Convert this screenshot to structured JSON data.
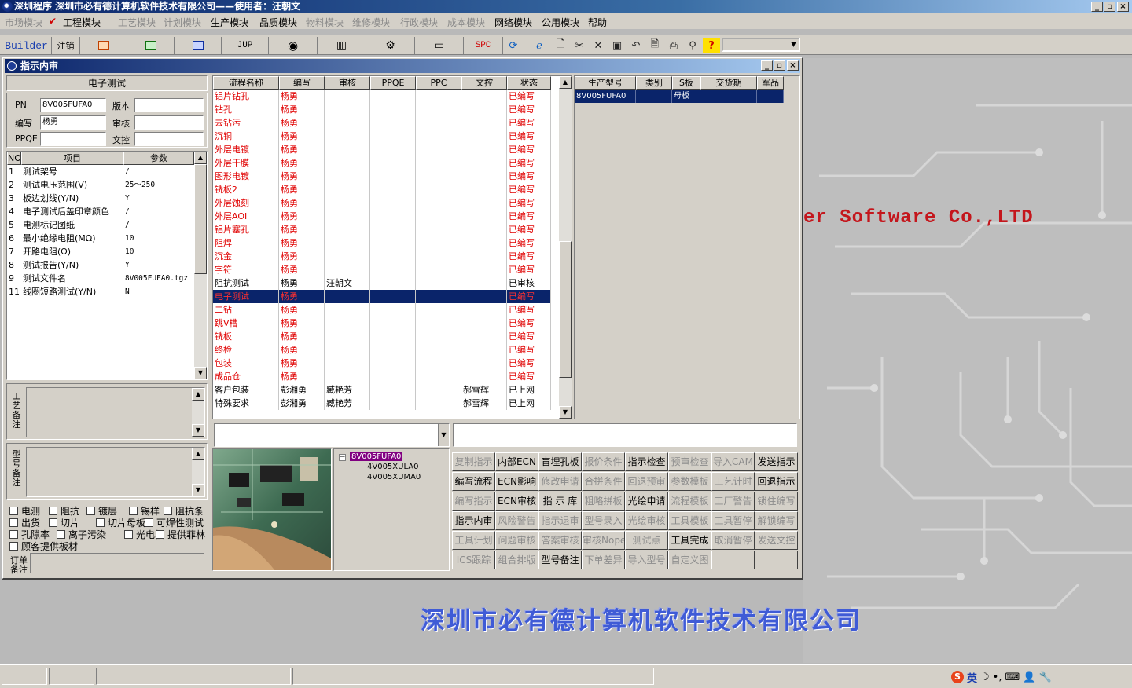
{
  "app": {
    "title": "深圳程序    深圳市必有德计算机软件技术有限公司——使用者：汪朝文",
    "controls": [
      "_",
      "▫",
      "×"
    ]
  },
  "menu": [
    {
      "label": "市场模块",
      "enabled": false
    },
    {
      "label": "工程模块",
      "enabled": true,
      "checked": true
    },
    {
      "label": "工艺模块",
      "enabled": false
    },
    {
      "label": "计划模块",
      "enabled": false
    },
    {
      "label": "生产模块",
      "enabled": true
    },
    {
      "label": "品质模块",
      "enabled": true
    },
    {
      "label": "物料模块",
      "enabled": false
    },
    {
      "label": "维修模块",
      "enabled": false
    },
    {
      "label": "行政模块",
      "enabled": false
    },
    {
      "label": "成本模块",
      "enabled": false
    },
    {
      "label": "网络模块",
      "enabled": true
    },
    {
      "label": "公用模块",
      "enabled": true
    },
    {
      "label": "帮助",
      "enabled": true
    }
  ],
  "toolbar": {
    "builder": "Builder",
    "logout": "注销",
    "jup": "JUP",
    "spc": "SPC",
    "icons": [
      "ppt-icon",
      "excel-icon",
      "word-icon",
      "jup-icon",
      "eye-icon",
      "database-icon",
      "network-icon",
      "computer-icon",
      "spc-icon",
      "refresh-icon",
      "ie-icon",
      "new-icon",
      "cut-icon",
      "delete-icon",
      "save-icon",
      "undo-icon",
      "preview-icon",
      "print-icon",
      "find-icon",
      "help-icon"
    ]
  },
  "background": {
    "company_en": "er Software Co.,LTD",
    "company_cn": "深圳市必有德计算机软件技术有限公司"
  },
  "window": {
    "title": "指示内审",
    "left": {
      "section_title": "电子测试",
      "pn_label": "PN",
      "pn_value": "8V005FUFA0",
      "version_label": "版本",
      "version_value": "",
      "author_label": "编写",
      "author_value": "杨勇",
      "review_label": "审核",
      "review_value": "",
      "ppqe_label": "PPQE",
      "ppqe_value": "",
      "doc_label": "文控",
      "doc_value": "",
      "param_headers": [
        "NO",
        "项目",
        "参数"
      ],
      "params": [
        {
          "no": "1",
          "item": "测试架号",
          "value": "/"
        },
        {
          "no": "2",
          "item": "测试电压范围(V)",
          "value": "25～250"
        },
        {
          "no": "3",
          "item": "板边划线(Y/N)",
          "value": "Y"
        },
        {
          "no": "4",
          "item": "电子测试后盖印章颜色",
          "value": "/"
        },
        {
          "no": "5",
          "item": "电测标记图纸",
          "value": "/"
        },
        {
          "no": "6",
          "item": "最小绝缘电阻(MΩ)",
          "value": "10"
        },
        {
          "no": "7",
          "item": "开路电阻(Ω)",
          "value": "10"
        },
        {
          "no": "8",
          "item": "测试报告(Y/N)",
          "value": "Y"
        },
        {
          "no": "9",
          "item": "测试文件名",
          "value": "8V005FUFA0.tgz"
        },
        {
          "no": "11",
          "item": "线圈短路测试(Y/N)",
          "value": "N"
        }
      ],
      "process_note_label": "工艺备注",
      "model_note_label": "型号备注",
      "order_note_label": "订单备注",
      "checkboxes": [
        [
          "电测",
          "阻抗",
          "镀层",
          "锡样",
          "阻抗条"
        ],
        [
          "出货",
          "切片",
          "切片母板",
          "可焊性测试"
        ],
        [
          "孔隙率",
          "离子污染",
          "光电板",
          "提供菲林"
        ],
        [
          "顾客提供板材"
        ]
      ]
    },
    "process": {
      "headers": [
        "流程名称",
        "编写",
        "审核",
        "PPQE",
        "PPC",
        "文控",
        "状态"
      ],
      "rows": [
        {
          "name": "铝片钻孔",
          "author": "杨勇",
          "review": "",
          "ppqe": "",
          "ppc": "",
          "doc": "",
          "status": "已编写",
          "red": true
        },
        {
          "name": "钻孔",
          "author": "杨勇",
          "review": "",
          "ppqe": "",
          "ppc": "",
          "doc": "",
          "status": "已编写",
          "red": true
        },
        {
          "name": "去钻污",
          "author": "杨勇",
          "review": "",
          "ppqe": "",
          "ppc": "",
          "doc": "",
          "status": "已编写",
          "red": true
        },
        {
          "name": "沉铜",
          "author": "杨勇",
          "review": "",
          "ppqe": "",
          "ppc": "",
          "doc": "",
          "status": "已编写",
          "red": true
        },
        {
          "name": "外层电镀",
          "author": "杨勇",
          "review": "",
          "ppqe": "",
          "ppc": "",
          "doc": "",
          "status": "已编写",
          "red": true
        },
        {
          "name": "外层干膜",
          "author": "杨勇",
          "review": "",
          "ppqe": "",
          "ppc": "",
          "doc": "",
          "status": "已编写",
          "red": true
        },
        {
          "name": "图形电镀",
          "author": "杨勇",
          "review": "",
          "ppqe": "",
          "ppc": "",
          "doc": "",
          "status": "已编写",
          "red": true
        },
        {
          "name": "铣板2",
          "author": "杨勇",
          "review": "",
          "ppqe": "",
          "ppc": "",
          "doc": "",
          "status": "已编写",
          "red": true
        },
        {
          "name": "外层蚀刻",
          "author": "杨勇",
          "review": "",
          "ppqe": "",
          "ppc": "",
          "doc": "",
          "status": "已编写",
          "red": true
        },
        {
          "name": "外层AOI",
          "author": "杨勇",
          "review": "",
          "ppqe": "",
          "ppc": "",
          "doc": "",
          "status": "已编写",
          "red": true
        },
        {
          "name": "铝片塞孔",
          "author": "杨勇",
          "review": "",
          "ppqe": "",
          "ppc": "",
          "doc": "",
          "status": "已编写",
          "red": true
        },
        {
          "name": "阻焊",
          "author": "杨勇",
          "review": "",
          "ppqe": "",
          "ppc": "",
          "doc": "",
          "status": "已编写",
          "red": true
        },
        {
          "name": "沉金",
          "author": "杨勇",
          "review": "",
          "ppqe": "",
          "ppc": "",
          "doc": "",
          "status": "已编写",
          "red": true
        },
        {
          "name": "字符",
          "author": "杨勇",
          "review": "",
          "ppqe": "",
          "ppc": "",
          "doc": "",
          "status": "已编写",
          "red": true
        },
        {
          "name": "阻抗测试",
          "author": "杨勇",
          "review": "汪朝文",
          "ppqe": "",
          "ppc": "",
          "doc": "",
          "status": "已审核",
          "red": false
        },
        {
          "name": "电子测试",
          "author": "杨勇",
          "review": "",
          "ppqe": "",
          "ppc": "",
          "doc": "",
          "status": "已编写",
          "red": true,
          "selected": true
        },
        {
          "name": "二钻",
          "author": "杨勇",
          "review": "",
          "ppqe": "",
          "ppc": "",
          "doc": "",
          "status": "已编写",
          "red": true
        },
        {
          "name": "跳V槽",
          "author": "杨勇",
          "review": "",
          "ppqe": "",
          "ppc": "",
          "doc": "",
          "status": "已编写",
          "red": true
        },
        {
          "name": "铣板",
          "author": "杨勇",
          "review": "",
          "ppqe": "",
          "ppc": "",
          "doc": "",
          "status": "已编写",
          "red": true
        },
        {
          "name": "终检",
          "author": "杨勇",
          "review": "",
          "ppqe": "",
          "ppc": "",
          "doc": "",
          "status": "已编写",
          "red": true
        },
        {
          "name": "包装",
          "author": "杨勇",
          "review": "",
          "ppqe": "",
          "ppc": "",
          "doc": "",
          "status": "已编写",
          "red": true
        },
        {
          "name": "成品仓",
          "author": "杨勇",
          "review": "",
          "ppqe": "",
          "ppc": "",
          "doc": "",
          "status": "已编写",
          "red": true
        },
        {
          "name": "客户包装",
          "author": "彭湘勇",
          "review": "臧艳芳",
          "ppqe": "",
          "ppc": "",
          "doc": "郝雪辉",
          "status": "已上网",
          "red": false
        },
        {
          "name": "特殊要求",
          "author": "彭湘勇",
          "review": "臧艳芳",
          "ppqe": "",
          "ppc": "",
          "doc": "郝雪辉",
          "status": "已上网",
          "red": false
        }
      ]
    },
    "production": {
      "headers": [
        "生产型号",
        "类别",
        "S板",
        "交货期",
        "军品"
      ],
      "rows": [
        {
          "model": "8V005FUFA0",
          "type": "",
          "s_board": "母板",
          "delivery": "",
          "military": ""
        }
      ]
    },
    "combo_value": "",
    "text_value": "",
    "tree": {
      "root": "8V005FUFA0",
      "children": [
        "4V005XULA0",
        "4V005XUMA0"
      ]
    },
    "buttons": [
      [
        {
          "label": "复制指示",
          "enabled": false
        },
        {
          "label": "内部ECN",
          "enabled": true
        },
        {
          "label": "盲埋孔板",
          "enabled": true
        },
        {
          "label": "报价条件",
          "enabled": false
        },
        {
          "label": "指示检查",
          "enabled": true
        },
        {
          "label": "预审检查",
          "enabled": false
        },
        {
          "label": "导入CAM",
          "enabled": false
        },
        {
          "label": "发送指示",
          "enabled": true
        }
      ],
      [
        {
          "label": "编写流程",
          "enabled": true
        },
        {
          "label": "ECN影响",
          "enabled": true
        },
        {
          "label": "修改申请",
          "enabled": false
        },
        {
          "label": "合拼条件",
          "enabled": false
        },
        {
          "label": "回退预审",
          "enabled": false
        },
        {
          "label": "参数模板",
          "enabled": false
        },
        {
          "label": "工艺计时",
          "enabled": false
        },
        {
          "label": "回退指示",
          "enabled": true
        }
      ],
      [
        {
          "label": "编写指示",
          "enabled": false
        },
        {
          "label": "ECN审核",
          "enabled": true
        },
        {
          "label": "指 示 库",
          "enabled": true
        },
        {
          "label": "粗略拼板",
          "enabled": false
        },
        {
          "label": "光绘申请",
          "enabled": true
        },
        {
          "label": "流程模板",
          "enabled": false
        },
        {
          "label": "工厂警告",
          "enabled": false
        },
        {
          "label": "锁住编写",
          "enabled": false
        }
      ],
      [
        {
          "label": "指示内审",
          "enabled": true
        },
        {
          "label": "风险警告",
          "enabled": false
        },
        {
          "label": "指示退审",
          "enabled": false
        },
        {
          "label": "型号录入",
          "enabled": false
        },
        {
          "label": "光绘审核",
          "enabled": false
        },
        {
          "label": "工具模板",
          "enabled": false
        },
        {
          "label": "工具暂停",
          "enabled": false
        },
        {
          "label": "解锁编写",
          "enabled": false
        }
      ],
      [
        {
          "label": "工具计划",
          "enabled": false
        },
        {
          "label": "问题审核",
          "enabled": false
        },
        {
          "label": "答案审核",
          "enabled": false
        },
        {
          "label": "审核Nope",
          "enabled": false
        },
        {
          "label": "测试点",
          "enabled": false
        },
        {
          "label": "工具完成",
          "enabled": true
        },
        {
          "label": "取消暂停",
          "enabled": false
        },
        {
          "label": "发送文控",
          "enabled": false
        }
      ],
      [
        {
          "label": "ICS跟踪",
          "enabled": false
        },
        {
          "label": "组合排版",
          "enabled": false
        },
        {
          "label": "型号备注",
          "enabled": true
        },
        {
          "label": "下单差异",
          "enabled": false
        },
        {
          "label": "导入型号",
          "enabled": false
        },
        {
          "label": "自定义图",
          "enabled": false
        },
        {
          "label": "",
          "enabled": false
        },
        {
          "label": "",
          "enabled": false
        }
      ]
    ]
  },
  "status_bar": {
    "panes": [
      "",
      "",
      "",
      ""
    ],
    "ime": "英"
  },
  "colors": {
    "title_start": "#0a246a",
    "title_end": "#a6caf0",
    "face": "#d4d0c8",
    "desktop": "#b9b9b9",
    "written_red": "#e00000",
    "selection": "#0a246a",
    "background_text_red": "#c4161c",
    "background_text_blue": "#3f5bd6"
  }
}
